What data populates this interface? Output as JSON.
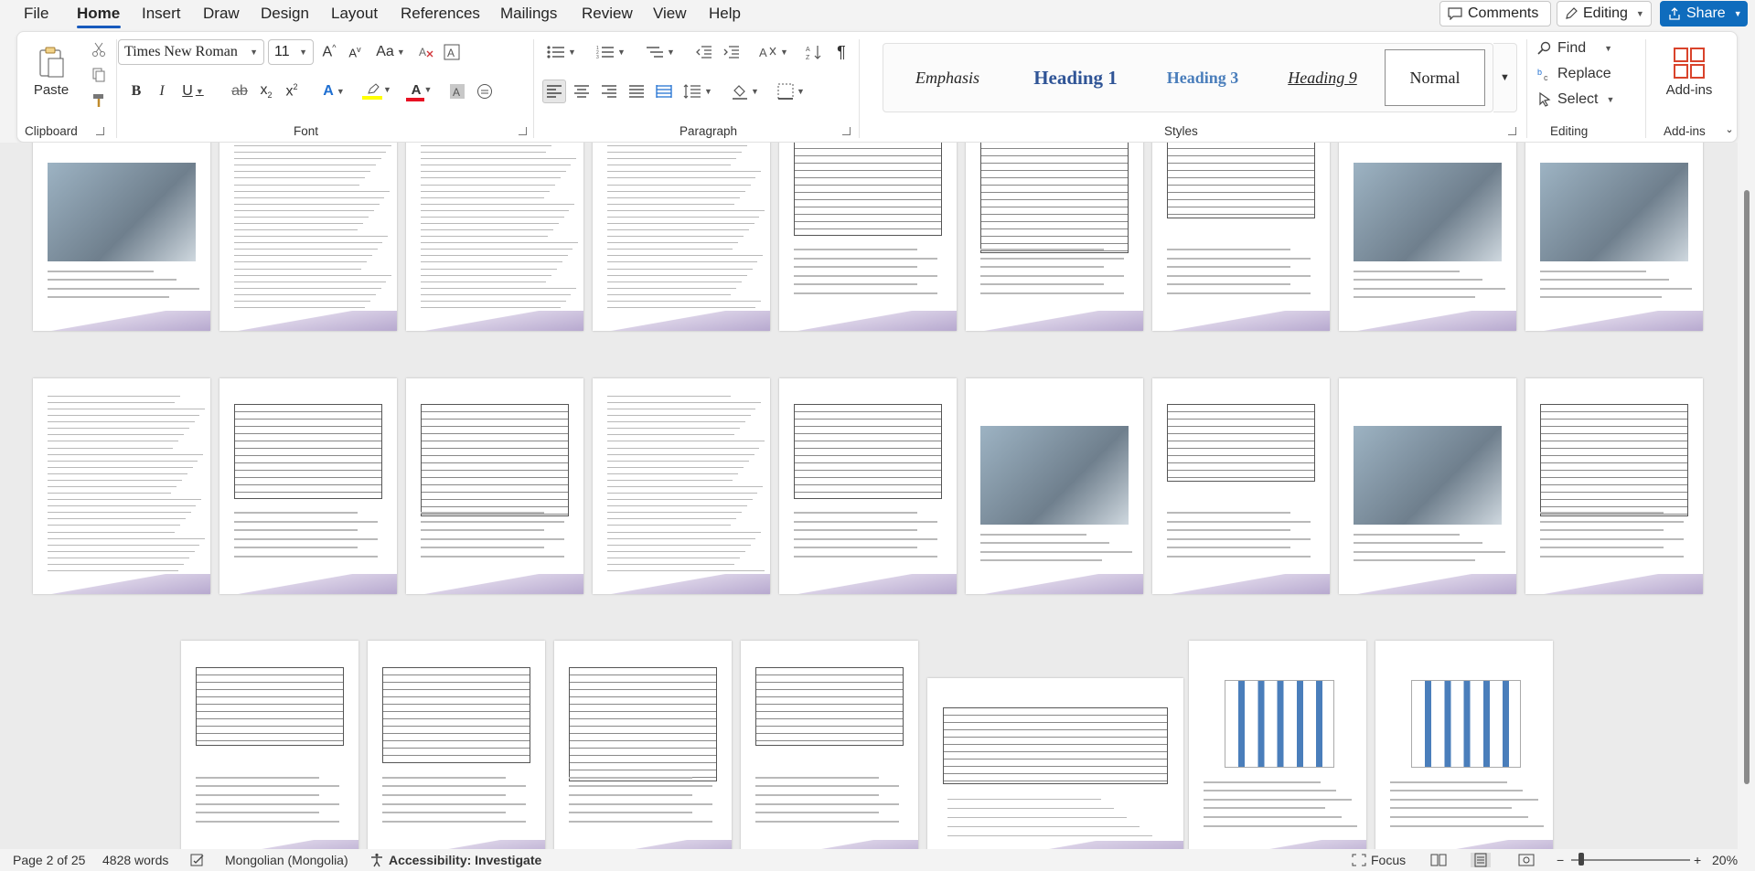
{
  "menu": {
    "tabs": [
      "File",
      "Home",
      "Insert",
      "Draw",
      "Design",
      "Layout",
      "References",
      "Mailings",
      "Review",
      "View",
      "Help"
    ],
    "comments_label": "Comments",
    "editing_label": "Editing",
    "share_label": "Share"
  },
  "ribbon": {
    "clipboard": {
      "paste_label": "Paste",
      "group_label": "Clipboard"
    },
    "font": {
      "font_name": "Times New Roman",
      "font_size": "11",
      "group_label": "Font",
      "change_case_label": "Aa"
    },
    "paragraph": {
      "group_label": "Paragraph"
    },
    "styles": {
      "items": [
        "Emphasis",
        "Heading 1",
        "Heading 3",
        "Heading 9",
        "Normal"
      ],
      "group_label": "Styles"
    },
    "editing": {
      "find_label": "Find",
      "replace_label": "Replace",
      "select_label": "Select",
      "group_label": "Editing"
    },
    "addins": {
      "addins_label": "Add-ins",
      "group_label": "Add-ins"
    }
  },
  "colors": {
    "accent": "#185abd",
    "share": "#0f6cbd",
    "highlight": "#ffff00",
    "font_color": "#e81123"
  },
  "status": {
    "page": "Page 2 of 25",
    "words": "4828 words",
    "language": "Mongolian (Mongolia)",
    "accessibility": "Accessibility: Investigate",
    "focus": "Focus",
    "zoom": "20%"
  }
}
